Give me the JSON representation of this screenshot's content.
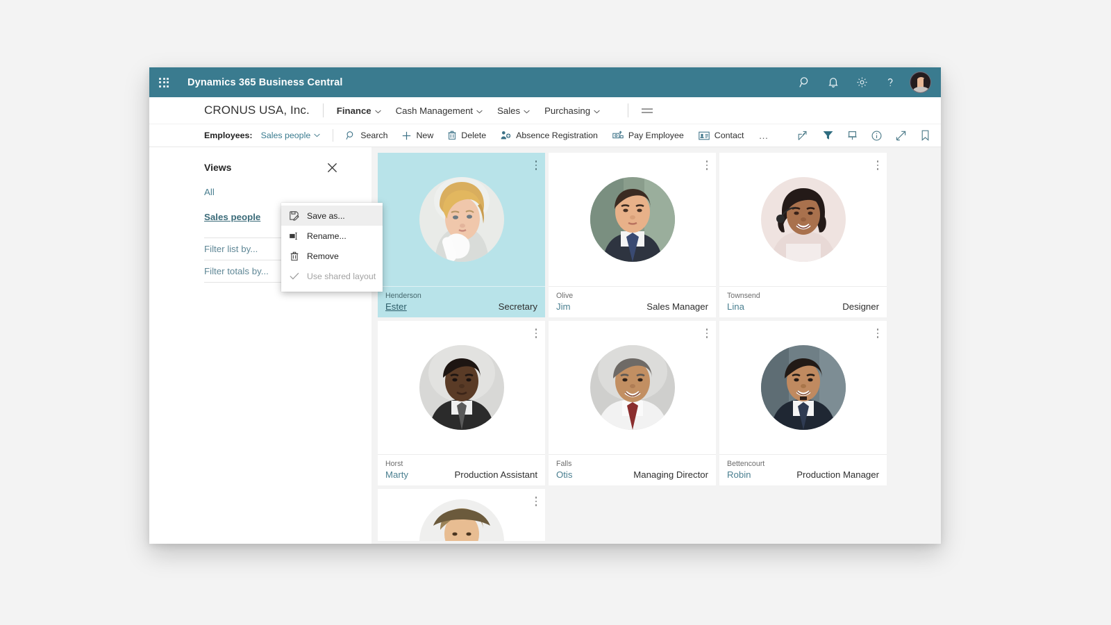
{
  "topbar": {
    "app_title": "Dynamics 365 Business Central",
    "waffle_icon": "app-launcher-icon",
    "icons": [
      "search-icon",
      "notification-bell-icon",
      "settings-gear-icon",
      "help-question-icon"
    ],
    "avatar": "user-avatar"
  },
  "nav": {
    "company": "CRONUS USA, Inc.",
    "items": [
      {
        "label": "Finance",
        "active": true,
        "has_chevron": true
      },
      {
        "label": "Cash Management",
        "active": false,
        "has_chevron": true
      },
      {
        "label": "Sales",
        "active": false,
        "has_chevron": true
      },
      {
        "label": "Purchasing",
        "active": false,
        "has_chevron": true
      }
    ],
    "more_icon": "list-hamburger-icon"
  },
  "actionbar": {
    "list_label": "Employees:",
    "list_value": "Sales people",
    "actions": [
      {
        "label": "Search",
        "icon": "search-icon"
      },
      {
        "label": "New",
        "icon": "plus-icon"
      },
      {
        "label": "Delete",
        "icon": "trash-icon"
      },
      {
        "label": "Absence Registration",
        "icon": "absence-icon"
      },
      {
        "label": "Pay Employee",
        "icon": "pay-employee-icon"
      },
      {
        "label": "Contact",
        "icon": "contact-card-icon"
      }
    ],
    "overflow_label": "…",
    "right_icons": [
      "share-icon",
      "filter-funnel-icon",
      "pin-icon",
      "info-circle-icon",
      "expand-arrows-icon",
      "bookmark-icon"
    ]
  },
  "views": {
    "title": "Views",
    "close_icon": "close-x-icon",
    "items": [
      {
        "label": "All",
        "selected": false
      },
      {
        "label": "Sales people",
        "selected": true
      }
    ],
    "dots_icon": "more-vertical-icon",
    "filters": [
      {
        "label": "Filter list by..."
      },
      {
        "label": "Filter totals by..."
      }
    ]
  },
  "context_menu": {
    "items": [
      {
        "label": "Save as...",
        "icon": "save-as-icon",
        "hover": true,
        "disabled": false
      },
      {
        "label": "Rename...",
        "icon": "rename-icon",
        "hover": false,
        "disabled": false
      },
      {
        "label": "Remove",
        "icon": "trash-icon",
        "hover": false,
        "disabled": false
      },
      {
        "label": "Use shared layout",
        "icon": "checkmark-icon",
        "hover": false,
        "disabled": true
      }
    ]
  },
  "employees": [
    {
      "surname": "Henderson",
      "given": "Ester",
      "title": "Secretary",
      "selected": true
    },
    {
      "surname": "Olive",
      "given": "Jim",
      "title": "Sales Manager",
      "selected": false
    },
    {
      "surname": "Townsend",
      "given": "Lina",
      "title": "Designer",
      "selected": false
    },
    {
      "surname": "Horst",
      "given": "Marty",
      "title": "Production Assistant",
      "selected": false
    },
    {
      "surname": "Falls",
      "given": "Otis",
      "title": "Managing Director",
      "selected": false
    },
    {
      "surname": "Bettencourt",
      "given": "Robin",
      "title": "Production Manager",
      "selected": false
    }
  ],
  "colors": {
    "brand_teal": "#3a7b8f",
    "selected_card": "#b8e3e9",
    "link": "#4a7f90",
    "page_bg": "#f3f3f3"
  }
}
